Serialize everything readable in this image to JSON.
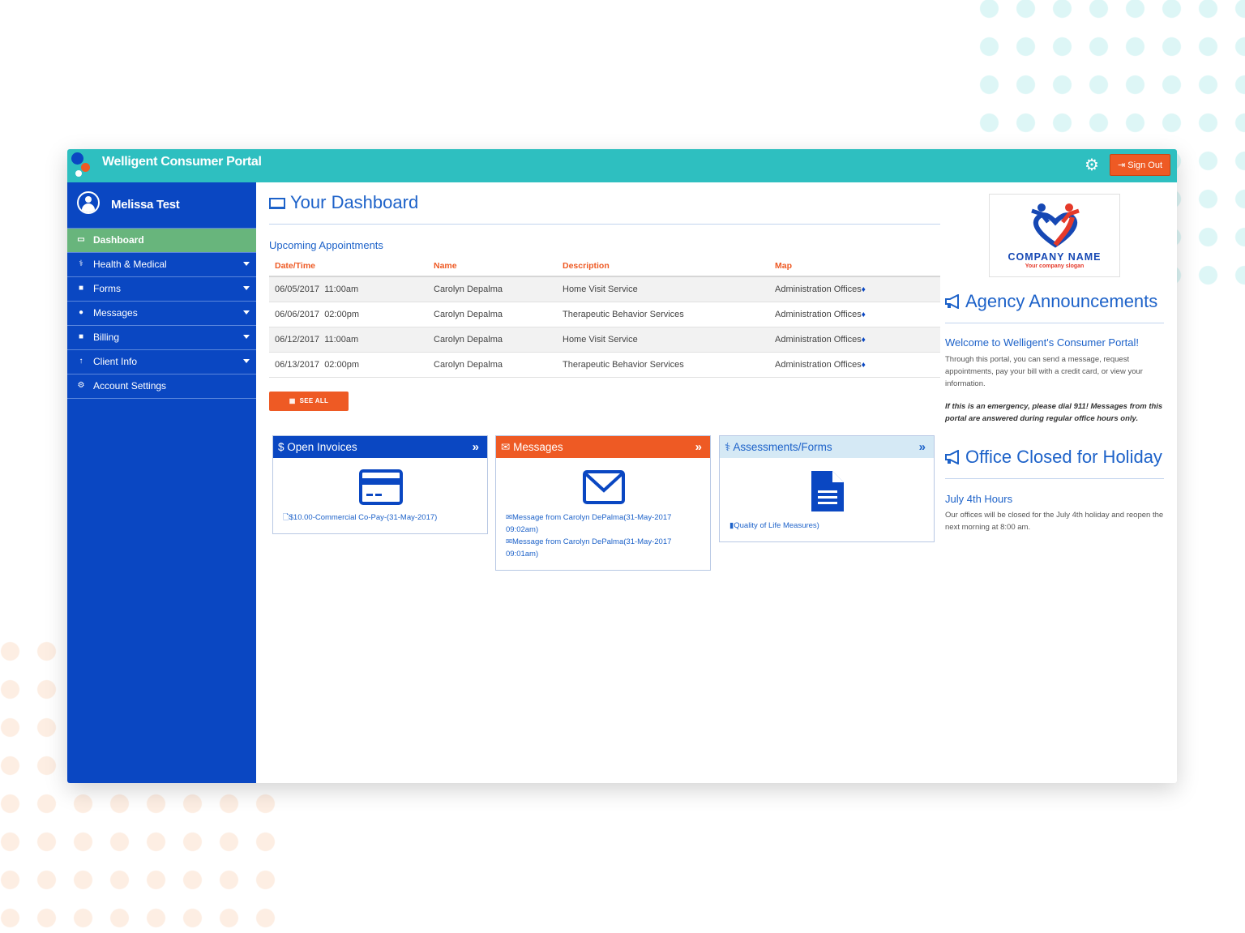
{
  "app": {
    "title": "Welligent Consumer Portal",
    "sign_out_label": "Sign Out"
  },
  "user": {
    "name": "Melissa Test"
  },
  "sidebar": {
    "items": [
      {
        "label": "Dashboard",
        "icon": "laptop-icon",
        "active": true,
        "has_submenu": false
      },
      {
        "label": "Health & Medical",
        "icon": "stethoscope-icon",
        "active": false,
        "has_submenu": true
      },
      {
        "label": "Forms",
        "icon": "file-icon",
        "active": false,
        "has_submenu": true
      },
      {
        "label": "Messages",
        "icon": "comment-icon",
        "active": false,
        "has_submenu": true
      },
      {
        "label": "Billing",
        "icon": "file-icon",
        "active": false,
        "has_submenu": true
      },
      {
        "label": "Client Info",
        "icon": "pin-icon",
        "active": false,
        "has_submenu": true
      },
      {
        "label": "Account Settings",
        "icon": "gear-icon",
        "active": false,
        "has_submenu": false
      }
    ]
  },
  "dashboard": {
    "title": "Your Dashboard",
    "appointments": {
      "title": "Upcoming Appointments",
      "columns": [
        "Date/Time",
        "Name",
        "Description",
        "Map"
      ],
      "rows": [
        {
          "date": "06/05/2017",
          "time": "11:00am",
          "name": "Carolyn Depalma",
          "description": "Home Visit Service",
          "map": "Administration Offices"
        },
        {
          "date": "06/06/2017",
          "time": "02:00pm",
          "name": "Carolyn Depalma",
          "description": "Therapeutic Behavior Services",
          "map": "Administration Offices"
        },
        {
          "date": "06/12/2017",
          "time": "11:00am",
          "name": "Carolyn Depalma",
          "description": "Home Visit Service",
          "map": "Administration Offices"
        },
        {
          "date": "06/13/2017",
          "time": "02:00pm",
          "name": "Carolyn Depalma",
          "description": "Therapeutic Behavior Services",
          "map": "Administration Offices"
        }
      ],
      "see_all_label": "SEE ALL"
    },
    "panels": {
      "invoices": {
        "title": "Open Invoices",
        "prefix": "$",
        "links": [
          "$10.00-Commercial Co-Pay-(31-May-2017)"
        ]
      },
      "messages": {
        "title": "Messages",
        "links": [
          "Message from Carolyn DePalma(31-May-2017 09:02am)",
          "Message from Carolyn DePalma(31-May-2017 09:01am)"
        ]
      },
      "assessments": {
        "title": "Assessments/Forms",
        "links": [
          "Quality of Life Measures)"
        ]
      }
    }
  },
  "right": {
    "company": {
      "name": "COMPANY NAME",
      "slogan": "Your company slogan"
    },
    "announcements": {
      "title": "Agency Announcements",
      "welcome_title": "Welcome to Welligent's Consumer Portal!",
      "welcome_text": "Through this portal, you can send a message, request appointments, pay your bill with a credit card, or view your information.",
      "emergency_text": "If this is an emergency, please dial 911! Messages from this portal are answered during regular office hours only."
    },
    "holiday": {
      "title": "Office Closed for Holiday",
      "subtitle": "July 4th Hours",
      "text": "Our offices will be closed for the July 4th holiday and reopen the next morning at 8:00 am."
    }
  },
  "colors": {
    "topbar": "#2ebfc0",
    "sidebar": "#0a47c2",
    "active_nav": "#68b57c",
    "accent_orange": "#ee5a24",
    "link_blue": "#1d62c9",
    "assess_header": "#d5e9f5"
  }
}
